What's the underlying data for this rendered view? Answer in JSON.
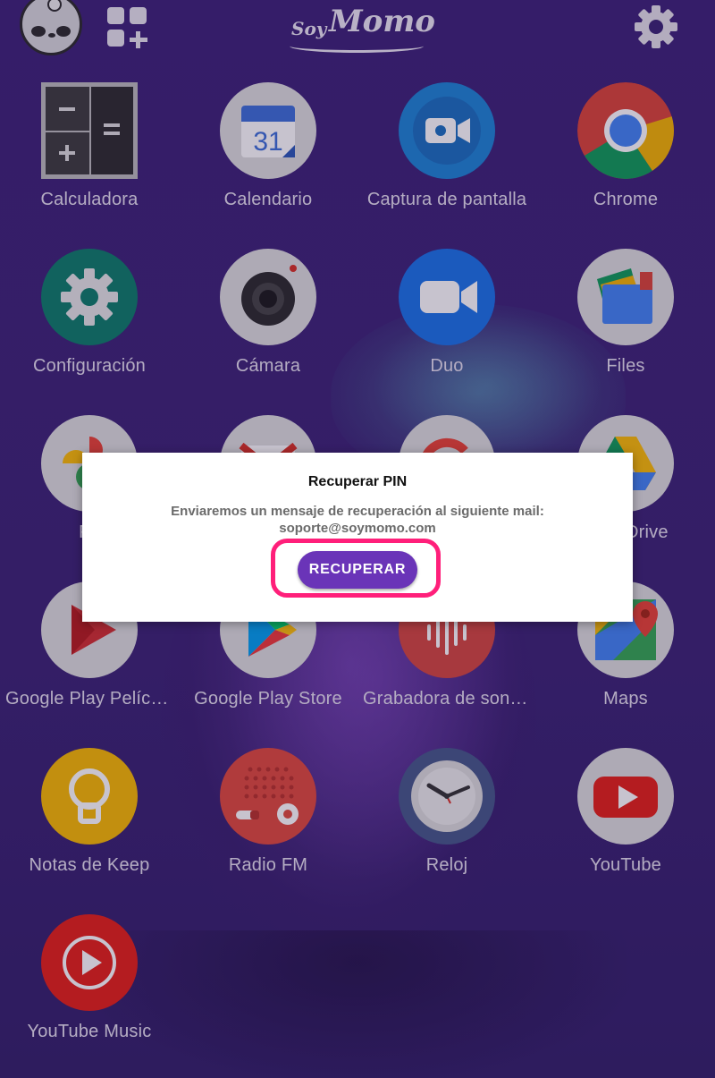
{
  "header": {
    "logo": {
      "soy": "Soy",
      "momo": "Momo"
    },
    "left_icons": [
      "panda-avatar-icon",
      "add-widget-icon"
    ],
    "right_icon": "settings-gear-icon"
  },
  "apps": [
    {
      "label": "Calculadora",
      "icon": "calculator-icon"
    },
    {
      "label": "Calendario",
      "icon": "calendar-icon",
      "badge": "31"
    },
    {
      "label": "Captura de pantalla",
      "icon": "screen-capture-icon"
    },
    {
      "label": "Chrome",
      "icon": "chrome-icon"
    },
    {
      "label": "Configuración",
      "icon": "settings-icon"
    },
    {
      "label": "Cámara",
      "icon": "camera-icon"
    },
    {
      "label": "Duo",
      "icon": "duo-icon"
    },
    {
      "label": "Files",
      "icon": "files-icon"
    },
    {
      "label": "Fo",
      "icon": "photos-icon"
    },
    {
      "label": "",
      "icon": "gmail-icon"
    },
    {
      "label": "",
      "icon": "google-icon"
    },
    {
      "label": "Drive",
      "icon": "drive-icon"
    },
    {
      "label": "Google Play Pelícu…",
      "icon": "play-movies-icon"
    },
    {
      "label": "Google Play Store",
      "icon": "play-store-icon"
    },
    {
      "label": "Grabadora de soni…",
      "icon": "sound-recorder-icon"
    },
    {
      "label": "Maps",
      "icon": "maps-icon"
    },
    {
      "label": "Notas de Keep",
      "icon": "keep-icon"
    },
    {
      "label": "Radio FM",
      "icon": "radio-icon"
    },
    {
      "label": "Reloj",
      "icon": "clock-icon"
    },
    {
      "label": "YouTube",
      "icon": "youtube-icon"
    },
    {
      "label": "YouTube Music",
      "icon": "youtube-music-icon"
    }
  ],
  "dialog": {
    "title": "Recuperar PIN",
    "message_line1": "Enviaremos un mensaje de recuperación al siguiente mail:",
    "message_line2": "soporte@soymomo.com",
    "button_label": "RECUPERAR",
    "highlight_color": "#ff1f7a",
    "button_color": "#6a34b8"
  },
  "colors": {
    "background": "#3a2374",
    "label_text": "#e6e1ef"
  }
}
